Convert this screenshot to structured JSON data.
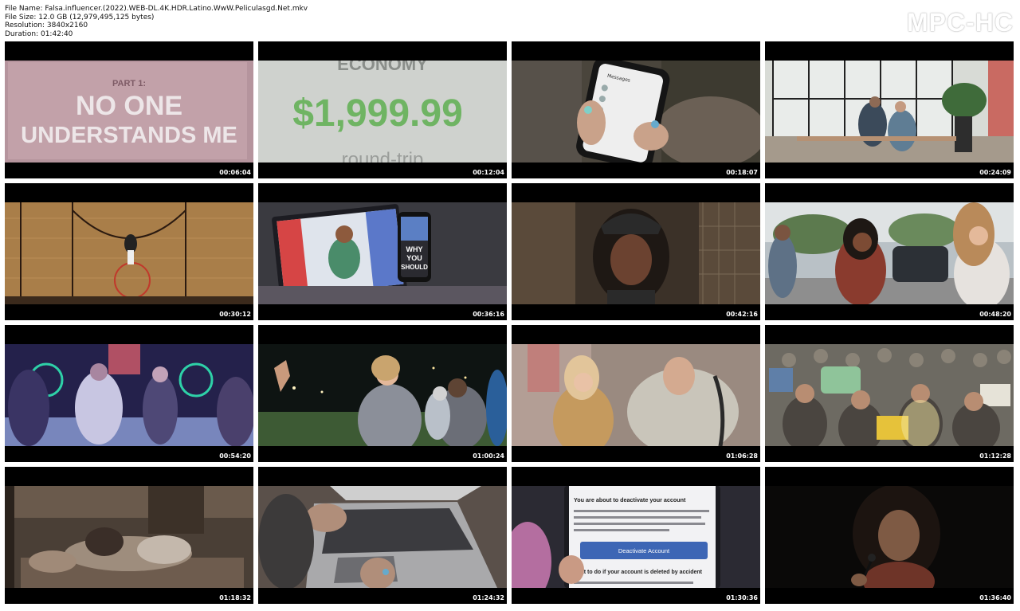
{
  "header": {
    "file_name": "File Name: Falsa.influencer.(2022).WEB-DL.4K.HDR.Latino.WwW.Peliculasgd.Net.mkv",
    "file_size": "File Size: 12.0 GB (12,979,495,125 bytes)",
    "resolution": "Resolution: 3840x2160",
    "duration": "Duration: 01:42:40"
  },
  "logo": "MPC-HC",
  "thumbnails": [
    {
      "timestamp": "00:06:04",
      "title_line1": "PART 1:",
      "title_line2": "NO ONE",
      "title_line3": "UNDERSTANDS ME"
    },
    {
      "timestamp": "00:12:04",
      "word_top": "ECONOMY",
      "price": "$1,999.99",
      "word_bottom": "round-trip"
    },
    {
      "timestamp": "00:18:07",
      "phone_label": "Messages"
    },
    {
      "timestamp": "00:24:09"
    },
    {
      "timestamp": "00:30:12"
    },
    {
      "timestamp": "00:36:16",
      "phone_caption_1": "WHY",
      "phone_caption_2": "YOU",
      "phone_caption_3": "SHOULD"
    },
    {
      "timestamp": "00:42:16"
    },
    {
      "timestamp": "00:48:20"
    },
    {
      "timestamp": "00:54:20"
    },
    {
      "timestamp": "01:00:24"
    },
    {
      "timestamp": "01:06:28"
    },
    {
      "timestamp": "01:12:28"
    },
    {
      "timestamp": "01:18:32"
    },
    {
      "timestamp": "01:24:32"
    },
    {
      "timestamp": "01:30:36",
      "dialog_title": "You are about to deactivate your account",
      "dialog_button": "Deactivate Account",
      "dialog_subtitle": "What to do if your account is deleted by accident"
    },
    {
      "timestamp": "01:36:40"
    }
  ]
}
